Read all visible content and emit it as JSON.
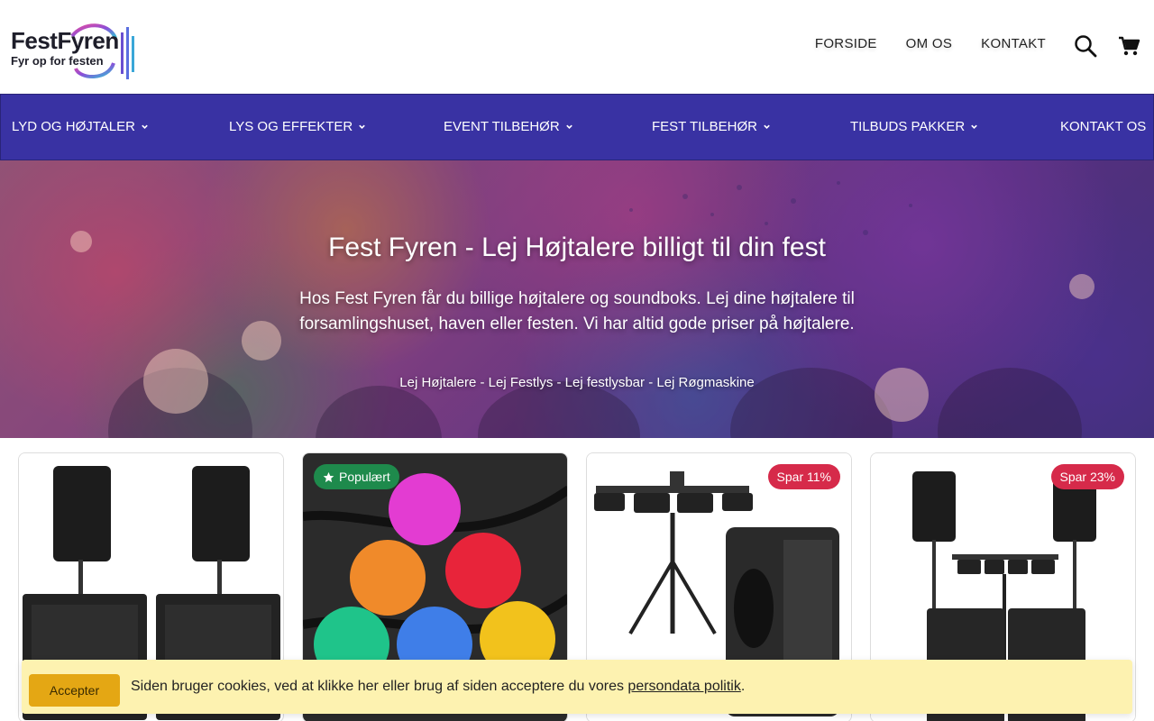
{
  "header": {
    "logo_name": "FestFyren",
    "logo_tagline": "Fyr op for festen",
    "nav": [
      {
        "label": "FORSIDE"
      },
      {
        "label": "OM OS"
      },
      {
        "label": "KONTAKT"
      }
    ],
    "icons": [
      "search-icon",
      "cart-icon"
    ]
  },
  "category_bar": {
    "color": "#3932a3",
    "items": [
      {
        "label": "LYD OG HØJTALER",
        "has_dropdown": true
      },
      {
        "label": "LYS OG EFFEKTER",
        "has_dropdown": true
      },
      {
        "label": "EVENT TILBEHØR",
        "has_dropdown": true
      },
      {
        "label": "FEST TILBEHØR",
        "has_dropdown": true
      },
      {
        "label": "TILBUDS PAKKER",
        "has_dropdown": true
      },
      {
        "label": "KONTAKT OS",
        "has_dropdown": false
      }
    ]
  },
  "hero": {
    "title": "Fest Fyren - Lej Højtalere billigt til din fest",
    "text": "Hos Fest Fyren får du billige højtalere og soundboks. Lej dine højtalere til forsamlingshuset, haven eller festen. Vi har altid gode priser på højtalere.",
    "links": "Lej Højtalere - Lej Festlys - Lej festlysbar - Lej Røgmaskine"
  },
  "products": [
    {
      "badge": "",
      "image": "speaker-pair-image"
    },
    {
      "badge": "Populært",
      "badge_icon": "star-icon",
      "badge_color": "#1e8a4c",
      "image": "led-balls-image"
    },
    {
      "badge": "Spar 11%",
      "badge_color": "#d62a4a",
      "image": "lightbar-soundboks-image"
    },
    {
      "badge": "Spar 23%",
      "badge_color": "#d62a4a",
      "image": "speaker-lightbar-package-image"
    }
  ],
  "cookie": {
    "button_label": "Accepter",
    "text": "Siden bruger cookies, ved at klikke her eller brug af siden acceptere du vores ",
    "link_label": "persondata politik",
    "suffix": ".",
    "background": "#fdf2b0",
    "button_color": "#e4a714"
  }
}
